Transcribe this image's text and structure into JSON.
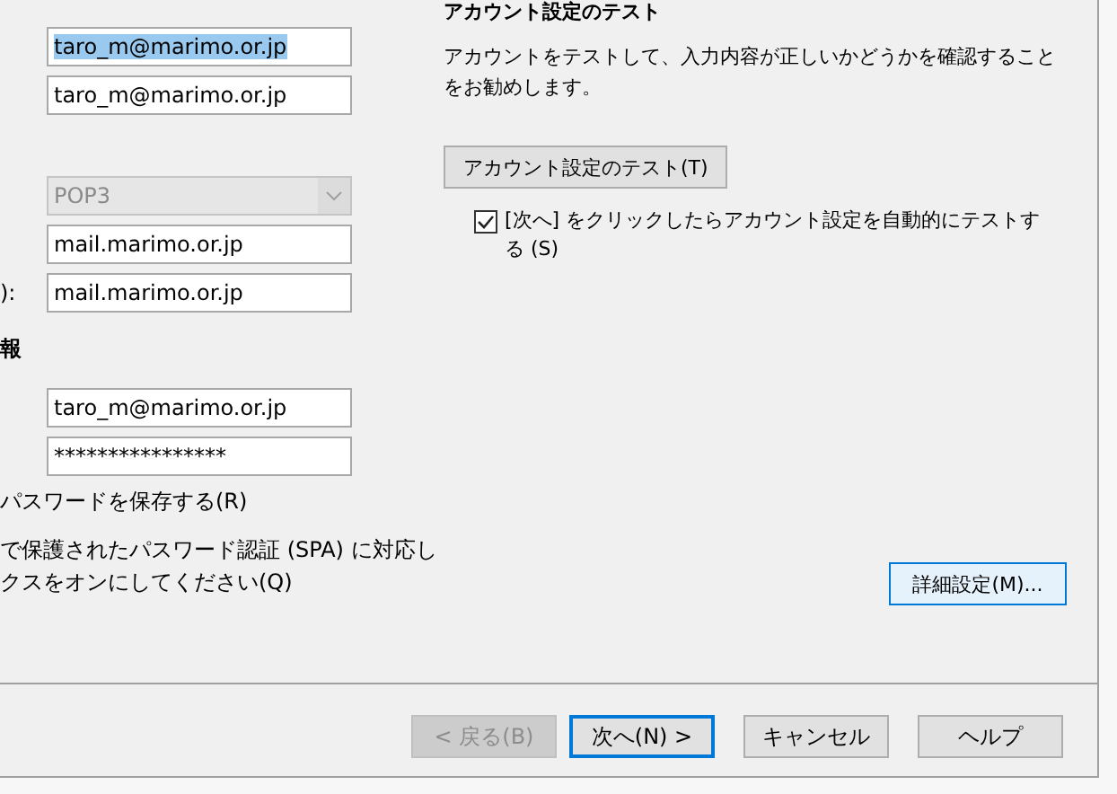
{
  "account_fields": [
    {
      "value": "taro_m@marimo.or.jp",
      "selected": true
    },
    {
      "value": "taro_m@marimo.or.jp",
      "selected": false
    }
  ],
  "server": {
    "account_type": {
      "value": "POP3",
      "disabled": true
    },
    "incoming": "mail.marimo.or.jp",
    "outgoing_label": "):",
    "outgoing": "mail.marimo.or.jp"
  },
  "login": {
    "heading": "報",
    "user": "taro_m@marimo.or.jp",
    "password": "****************",
    "remember_label": "パスワードを保存する(R)",
    "spa_lines": [
      "で保護されたパスワード認証 (SPA) に対応し",
      "クスをオンにしてください(Q)"
    ]
  },
  "test": {
    "title": "アカウント設定のテスト",
    "description": "アカウントをテストして、入力内容が正しいかどうかを確認することをお勧めします。",
    "test_button": "アカウント設定のテスト(T)",
    "auto_test": {
      "label": "[次へ] をクリックしたらアカウント設定を自動的にテストする (S)",
      "checked": true
    }
  },
  "details_button": {
    "label": "詳細設定(M)...",
    "highlighted": true
  },
  "buttons": [
    {
      "label": "< 戻る(B)",
      "disabled": true,
      "default": false
    },
    {
      "label": "次へ(N) >",
      "disabled": false,
      "default": true
    },
    {
      "label": "キャンセル",
      "disabled": false,
      "default": false
    },
    {
      "label": "ヘルプ",
      "disabled": false,
      "default": false
    }
  ]
}
